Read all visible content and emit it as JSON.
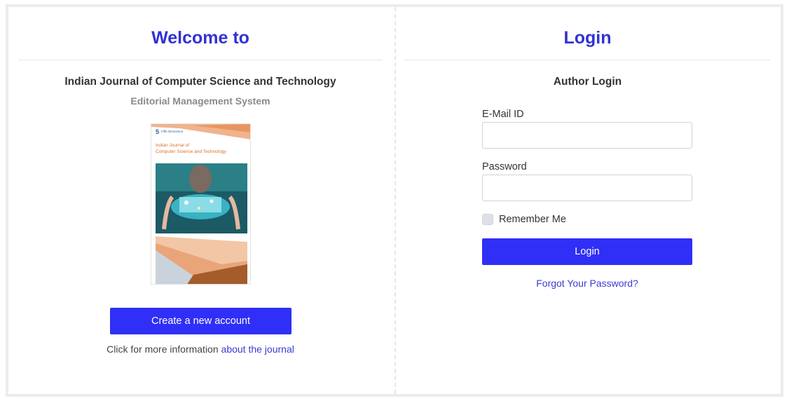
{
  "welcome": {
    "title": "Welcome to",
    "journal_name": "Indian Journal of Computer Science and Technology",
    "subtitle": "Editorial Management System",
    "cover": {
      "publisher_mark": "5",
      "publisher_text": "Fifth Dimension",
      "title_line1": "Indian Journal of",
      "title_line2": "Computer Science and Technology"
    },
    "create_account_label": "Create a new account",
    "info_text": "Click for more information ",
    "info_link": "about the journal"
  },
  "login": {
    "title": "Login",
    "section_title": "Author Login",
    "email_label": "E-Mail ID",
    "email_value": "",
    "password_label": "Password",
    "password_value": "",
    "remember_label": "Remember Me",
    "remember_checked": false,
    "login_button": "Login",
    "forgot_link": "Forgot Your Password?"
  },
  "colors": {
    "accent": "#2f2ff7",
    "title": "#3131d6",
    "link": "#3a3ad6",
    "cover_orange": "#e9a47a",
    "cover_teal": "#1f8a8a"
  }
}
